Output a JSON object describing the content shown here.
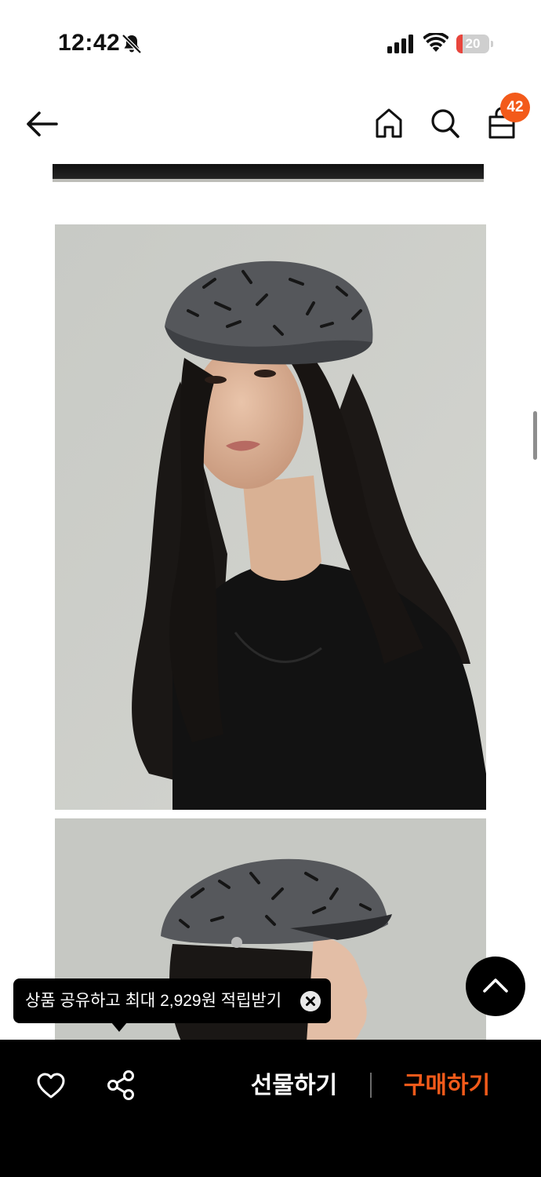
{
  "status_bar": {
    "time": "12:42",
    "battery_level": "20",
    "icons": [
      "bell-slash-icon",
      "cellular-signal-icon",
      "wifi-icon",
      "battery-icon"
    ]
  },
  "header": {
    "icons": [
      "back-arrow-icon",
      "home-icon",
      "search-icon",
      "shopping-bag-icon"
    ],
    "cart_badge": "42",
    "accent_color": "#f35a1a"
  },
  "tooltip": {
    "text": "상품 공유하고 최대 2,929원 적립받기",
    "close_icon": "close-circle-icon"
  },
  "scroll_top": {
    "icon": "chevron-up-icon"
  },
  "bottom_bar": {
    "like_icon": "heart-outline-icon",
    "share_icon": "share-icon",
    "gift_label": "선물하기",
    "buy_label": "구매하기",
    "buy_color": "#f35a1a"
  }
}
